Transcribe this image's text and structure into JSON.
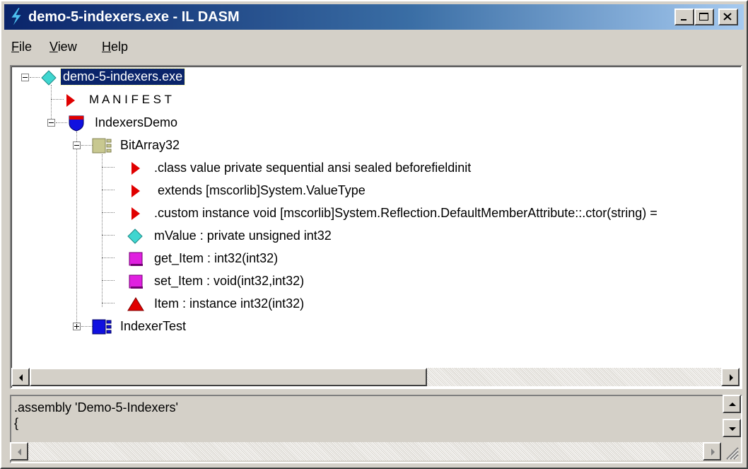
{
  "window": {
    "title": "demo-5-indexers.exe - IL DASM"
  },
  "menu": [
    {
      "accel": "F",
      "rest": "ile"
    },
    {
      "accel": "V",
      "rest": "iew"
    },
    {
      "accel": "H",
      "rest": "elp"
    }
  ],
  "tree": {
    "root": "demo-5-indexers.exe",
    "manifest": "M A N I F E S T",
    "namespace": "IndexersDemo",
    "class_bitarray": "BitArray32",
    "items": [
      ".class value private sequential ansi sealed beforefieldinit",
      " extends [mscorlib]System.ValueType",
      ".custom instance void [mscorlib]System.Reflection.DefaultMemberAttribute::.ctor(string) =",
      "mValue : private unsigned int32",
      "get_Item : int32(int32)",
      "set_Item : void(int32,int32)",
      "Item : instance int32(int32)"
    ],
    "class_indexertest": "IndexerTest"
  },
  "text_pane": {
    "lines": [
      ".assembly 'Demo-5-Indexers'",
      "{"
    ]
  },
  "colors": {
    "title_start": "#0a246a",
    "title_end": "#a6caf0",
    "selection": "#0a246a",
    "manifest_arrow": "#e00000",
    "field_diamond": "#3fd6d0",
    "method_square": "#e020e0",
    "property_triangle": "#e00000",
    "class_icon": "#c8c890",
    "class_blue": "#1010e0"
  },
  "icons": [
    "flash-icon",
    "minimize-icon",
    "maximize-icon",
    "close-icon",
    "expand-icon",
    "collapse-icon"
  ]
}
